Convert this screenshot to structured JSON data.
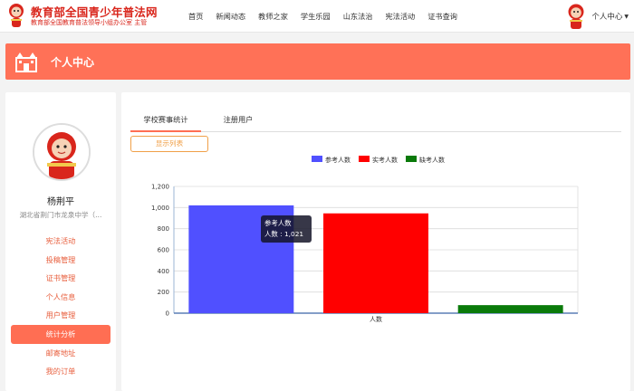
{
  "header": {
    "site_title": "教育部全国青少年普法网",
    "site_subtitle": "教育部全国教育普法领导小组办公室 主管",
    "nav": [
      "首页",
      "新闻动态",
      "教师之家",
      "学生乐园",
      "山东法治",
      "宪法活动",
      "证书查询"
    ],
    "user_name": "个人中心"
  },
  "banner": {
    "title": "个人中心"
  },
  "profile": {
    "name": "杨荆平",
    "school": "湖北省荆门市龙泉中学（..."
  },
  "menu": [
    {
      "label": "宪法活动",
      "active": false
    },
    {
      "label": "投稿管理",
      "active": false
    },
    {
      "label": "证书管理",
      "active": false
    },
    {
      "label": "个人信息",
      "active": false
    },
    {
      "label": "用户管理",
      "active": false
    },
    {
      "label": "统计分析",
      "active": true
    },
    {
      "label": "邮寄地址",
      "active": false
    },
    {
      "label": "我的订单",
      "active": false
    }
  ],
  "tabs": [
    {
      "label": "学校赛事统计",
      "active": true
    },
    {
      "label": "注册用户",
      "active": false
    }
  ],
  "show_list_button": "显示列表",
  "colors": {
    "accent": "#ff6e53",
    "series_participants": "#5050ff",
    "series_actual": "#ff0000",
    "series_absent": "#0a7a0a"
  },
  "chart_data": {
    "type": "bar",
    "categories": [
      "人数"
    ],
    "series": [
      {
        "name": "参考人数",
        "values": [
          1021
        ],
        "color": "#5050ff"
      },
      {
        "name": "实考人数",
        "values": [
          945
        ],
        "color": "#ff0000"
      },
      {
        "name": "缺考人数",
        "values": [
          76
        ],
        "color": "#0a7a0a"
      }
    ],
    "ylim": [
      0,
      1200
    ],
    "yticks": [
      "0",
      "200",
      "400",
      "600",
      "800",
      "1,000",
      "1,200"
    ],
    "legend": "top",
    "grid": true,
    "tooltip": {
      "title": "参考人数",
      "text": "人数 : 1,021"
    }
  }
}
